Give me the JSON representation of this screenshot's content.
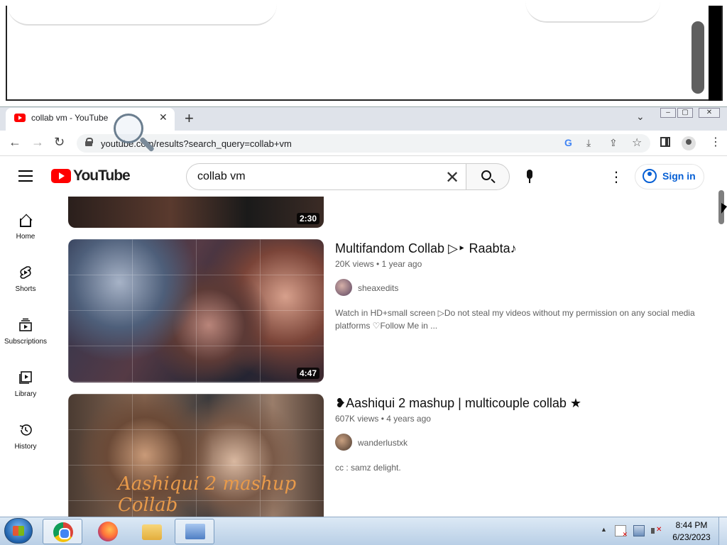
{
  "browser": {
    "tab_title": "collab vm - YouTube",
    "tab_close_glyph": "✕",
    "new_tab_glyph": "+",
    "tab_menu_glyph": "⌄",
    "window_buttons": {
      "minimize": "–",
      "maximize": "▢",
      "close": "✕"
    },
    "url": "youtube.com/results?search_query=collab+vm",
    "nav": {
      "back": "←",
      "forward": "→",
      "reload": "↻"
    },
    "omnibox_icons": {
      "google": "G",
      "install": "⤓",
      "share": "⇪",
      "bookmark": "☆"
    },
    "menu_glyph": "⋮"
  },
  "youtube": {
    "logo_text": "YouTube",
    "search_query": "collab vm",
    "clear_glyph": "✕",
    "more_glyph": "⋮",
    "sign_in": "Sign in",
    "sidebar": [
      {
        "label": "Home",
        "icon": "home-icon"
      },
      {
        "label": "Shorts",
        "icon": "shorts-icon"
      },
      {
        "label": "Subscriptions",
        "icon": "subscriptions-icon"
      },
      {
        "label": "Library",
        "icon": "library-icon"
      },
      {
        "label": "History",
        "icon": "history-icon"
      }
    ],
    "results": [
      {
        "duration": "2:30"
      },
      {
        "title": "Multifandom Collab ▷‣ Raabta♪",
        "views": "20K views",
        "age": "1 year ago",
        "meta": "20K views • 1 year ago",
        "channel": "sheaxedits",
        "description": "Watch in HD+small screen ▷Do not steal my videos without my permission on any social media platforms ♡Follow Me in ...",
        "duration": "4:47"
      },
      {
        "title": "❥Aashiqui 2 mashup | multicouple collab ★",
        "views": "607K views",
        "age": "4 years ago",
        "meta": "607K views • 4 years ago",
        "channel": "wanderlustxk",
        "description": "cc : samz delight.",
        "thumbnail_overlay": "Aashiqui 2 mashup Collab"
      }
    ]
  },
  "taskbar": {
    "pinned": [
      "chrome-icon",
      "firefox-icon",
      "explorer-icon",
      "remote-desktop-icon"
    ],
    "tray_arrow": "▲",
    "clock_time": "8:44 PM",
    "clock_date": "6/23/2023"
  },
  "colors": {
    "youtube_red": "#ff0000",
    "link_blue": "#065fd4",
    "meta_gray": "#606060"
  }
}
